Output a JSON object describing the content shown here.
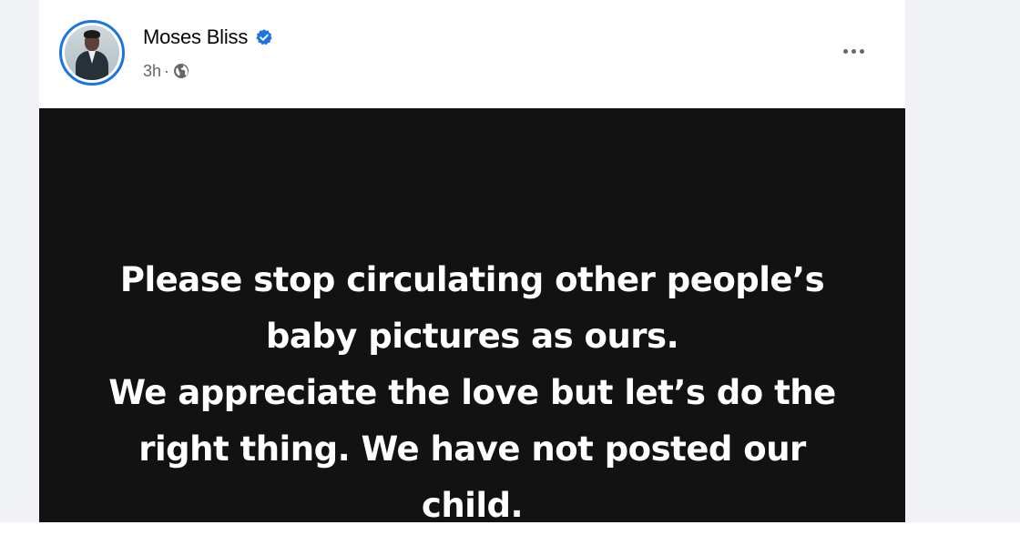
{
  "post": {
    "author": {
      "name": "Moses Bliss",
      "verified_icon": "verified-badge-icon",
      "avatar_icon": "profile-photo"
    },
    "meta": {
      "time": "3h",
      "separator": "·",
      "audience_icon": "globe-icon"
    },
    "menu_icon": "more-options-icon",
    "image_text_lines": [
      "Please stop circulating other people’s",
      "baby pictures as ours.",
      "We appreciate the love but let’s do the",
      "right thing. We have not posted our",
      "child."
    ]
  },
  "colors": {
    "verified_blue": "#1b74e4",
    "image_background": "#121212",
    "image_text": "#ffffff",
    "page_background": "#f0f2f5",
    "meta_gray": "#65676b"
  }
}
